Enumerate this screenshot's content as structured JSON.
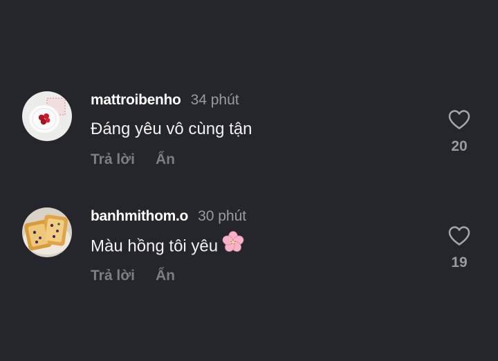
{
  "comments": [
    {
      "username": "mattroibenho",
      "time": "34 phút",
      "text": "Đáng yêu vô cùng tận",
      "reply_label": "Trả lời",
      "hide_label": "Ẩn",
      "like_count": "20"
    },
    {
      "username": "banhmithom.o",
      "time": "30 phút",
      "text": "Màu hồng tôi yêu",
      "reply_label": "Trả lời",
      "hide_label": "Ẩn",
      "like_count": "19"
    }
  ],
  "icons": {
    "like": "heart-icon",
    "emoji": "cherry-blossom-icon"
  },
  "colors": {
    "background": "#25262b",
    "username": "#ffffff",
    "meta": "#9a9ba0",
    "actions": "#7d7e84"
  }
}
